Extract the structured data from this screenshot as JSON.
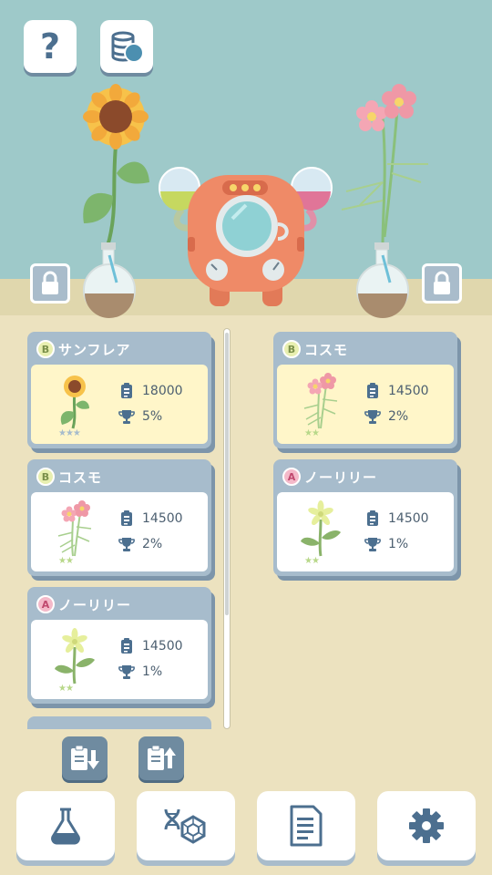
{
  "top_buttons": [
    {
      "name": "help",
      "label": "?"
    },
    {
      "name": "coins",
      "icon": "coin-stack-icon"
    }
  ],
  "colors": {
    "sky": "#9ec9c9",
    "floor": "#ece2bf",
    "card_header": "#a7bccc",
    "card_selected": "#fff6c9",
    "accent": "#4c6f8f",
    "robot": "#ef8a67"
  },
  "left_list": [
    {
      "grade": "B",
      "name": "サンフレア",
      "count": "18000",
      "rate": "5%",
      "stars": "★★★",
      "flower": "sunflower",
      "selected": true
    },
    {
      "grade": "B",
      "name": "コスモ",
      "count": "14500",
      "rate": "2%",
      "stars": "★★",
      "flower": "cosmos",
      "selected": false
    },
    {
      "grade": "A",
      "name": "ノーリリー",
      "count": "14500",
      "rate": "1%",
      "stars": "★★",
      "flower": "lily",
      "selected": false
    }
  ],
  "right_list": [
    {
      "grade": "B",
      "name": "コスモ",
      "count": "14500",
      "rate": "2%",
      "stars": "★★",
      "flower": "cosmos",
      "selected": true
    },
    {
      "grade": "A",
      "name": "ノーリリー",
      "count": "14500",
      "rate": "1%",
      "stars": "★★",
      "flower": "lily",
      "selected": false
    }
  ],
  "sort_buttons": [
    {
      "name": "sort-descending",
      "icon": "clipboard-arrow-down-icon"
    },
    {
      "name": "sort-ascending",
      "icon": "clipboard-arrow-up-icon"
    }
  ],
  "bottom_nav": [
    {
      "name": "lab",
      "icon": "flask-icon"
    },
    {
      "name": "gene",
      "icon": "dna-hexagon-icon"
    },
    {
      "name": "document",
      "icon": "document-icon"
    },
    {
      "name": "settings",
      "icon": "gear-icon"
    }
  ]
}
